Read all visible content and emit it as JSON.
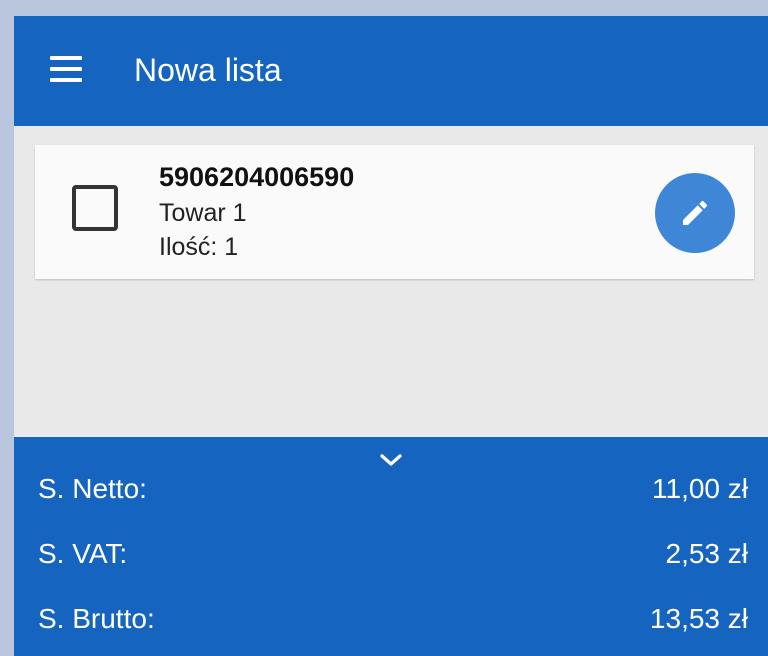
{
  "colors": {
    "primary": "#1565c0",
    "fab": "#3f87d6",
    "background": "#e9e9e9",
    "card": "#fafafa"
  },
  "appbar": {
    "menu_icon": "hamburger-menu-icon",
    "title": "Nowa lista"
  },
  "items": [
    {
      "code": "5906204006590",
      "name": "Towar 1",
      "quantity": "Ilość: 1",
      "checked": false,
      "edit_icon": "pencil-icon"
    }
  ],
  "summary": {
    "collapse_icon": "chevron-down-icon",
    "rows": [
      {
        "label": "S. Netto:",
        "value": "11,00 zł"
      },
      {
        "label": "S. VAT:",
        "value": "2,53 zł"
      },
      {
        "label": "S. Brutto:",
        "value": "13,53 zł"
      }
    ]
  }
}
